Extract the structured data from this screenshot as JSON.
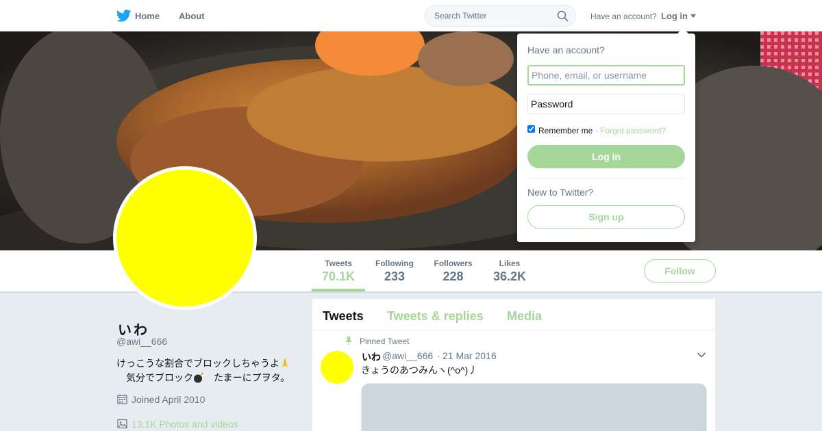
{
  "colors": {
    "accent": "#a5d79a",
    "text_primary": "#14171a",
    "text_secondary": "#657786",
    "avatar": "#ffff00",
    "background": "#e6ecf0"
  },
  "nav": {
    "home": "Home",
    "about": "About",
    "search_placeholder": "Search Twitter",
    "have_account": "Have an account?",
    "login": "Log in"
  },
  "stats": [
    {
      "label": "Tweets",
      "value": "70.1K",
      "active": true
    },
    {
      "label": "Following",
      "value": "233",
      "active": false
    },
    {
      "label": "Followers",
      "value": "228",
      "active": false
    },
    {
      "label": "Likes",
      "value": "36.2K",
      "active": false
    }
  ],
  "follow_button": "Follow",
  "profile": {
    "name": "いわ",
    "handle": "@awi__666",
    "bio_line1": "けっこうな割合でブロックしちゃうよ",
    "bio_line2_a": "気分でブロック",
    "bio_line2_b": "　たまーにプヲタ。",
    "joined": "Joined April 2010",
    "photos": "13.1K Photos and videos"
  },
  "timeline": {
    "tabs": [
      "Tweets",
      "Tweets & replies",
      "Media"
    ],
    "pinned_label": "Pinned Tweet",
    "tweet": {
      "name": "いわ",
      "handle": "@awi__666",
      "separator": "·",
      "date": "21 Mar 2016",
      "text": "きょうのあつみんヽ(^o^)丿"
    }
  },
  "login_panel": {
    "title": "Have an account?",
    "username_placeholder": "Phone, email, or username",
    "password_placeholder": "Password",
    "remember": "Remember me",
    "separator": "·",
    "forgot": "Forgot password?",
    "login_button": "Log in",
    "new_prompt": "New to Twitter?",
    "signup_button": "Sign up"
  }
}
